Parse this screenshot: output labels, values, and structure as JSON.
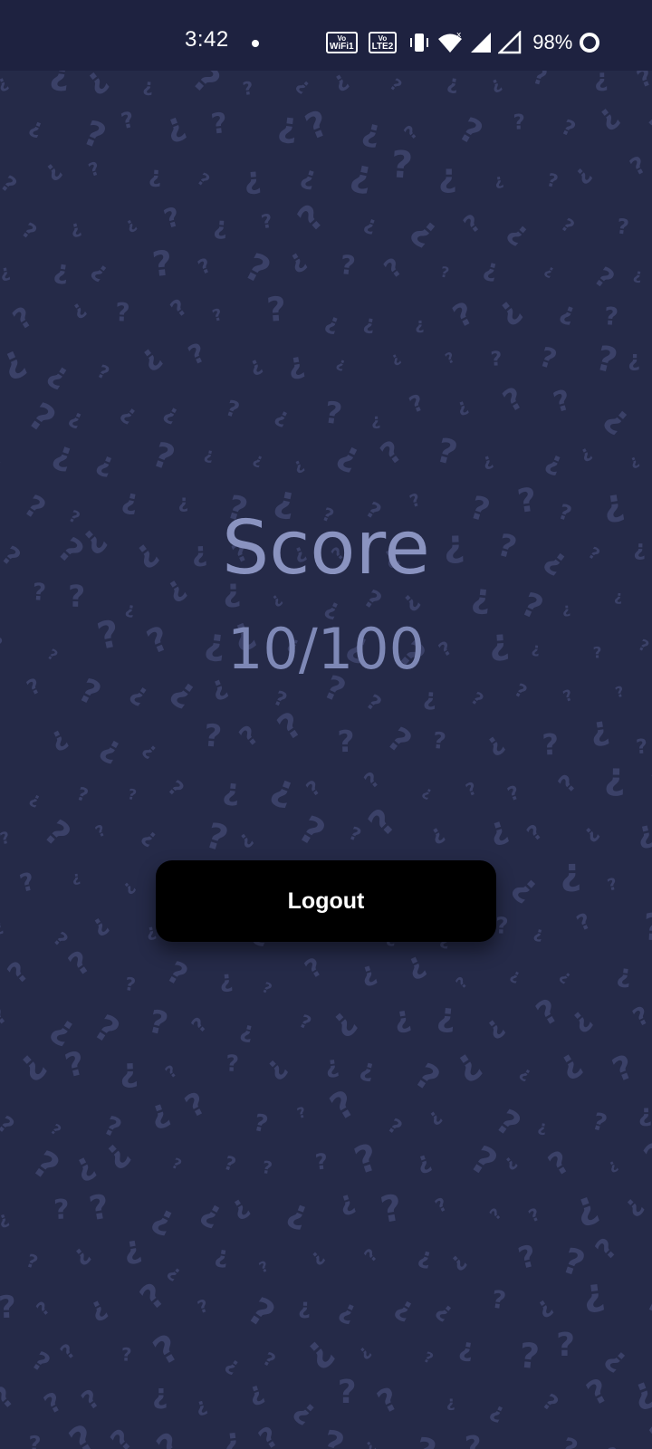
{
  "status_bar": {
    "time": "3:42",
    "vowifi_top": "Vo",
    "vowifi_bottom": "WiFi1",
    "volte_top": "Vo",
    "volte_bottom": "LTE2",
    "battery": "98%",
    "icons": [
      "notification-dot-icon",
      "vowifi-icon",
      "volte-icon",
      "vibrate-icon",
      "wifi-icon",
      "signal-icon",
      "signal-icon",
      "battery-icon"
    ]
  },
  "score": {
    "title": "Score",
    "value": "10/100"
  },
  "actions": {
    "logout_label": "Logout"
  },
  "colors": {
    "background": "#252a48",
    "status_bar": "#1e2240",
    "text_muted": "#8a93c0",
    "button": "#000000",
    "pattern": "#3b4168"
  }
}
